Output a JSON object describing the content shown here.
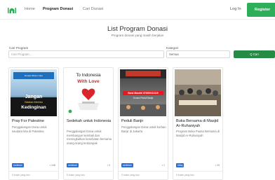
{
  "nav": {
    "links": [
      "Home",
      "Program Donasi",
      "Cari Donasi"
    ],
    "login": "Log In",
    "register": "Register"
  },
  "header": {
    "title": "List Program Donasi",
    "subtitle": "Program donasi yang masih berjalan"
  },
  "search": {
    "label": "Cari Program",
    "placeholder": "Cari Program...",
    "category_label": "Kategori",
    "category_value": "Semua",
    "button": "Q Cari"
  },
  "cards": [
    {
      "title": "Pray For Palestine",
      "desc": "Penggalangan Dana untuk saudara kita di Palestina",
      "badge": "sedekah",
      "stat": "• 148",
      "time": "5 bulan yang lalu",
      "poster": {
        "line1": "Jangan",
        "line2": "Biarkan Mereka",
        "line3": "Kedinginan",
        "line4": "Donasi Winter Care"
      }
    },
    {
      "title": "Sedekah untuk Indonesia",
      "desc": "Penggalangan Dana untuk membangun kembali dan meningkatkan kesehatan bersama orang-orang terdampak",
      "badge": "sedekah",
      "stat": "• 0",
      "time": "5 bulan yang lalu",
      "poster": {
        "line1": "To Indonesia",
        "line2": "With Love"
      }
    },
    {
      "title": "Peduli Banjir",
      "desc": "Penggalangan Dana untuk korban Banjir di Jakarta",
      "badge": "sedekah",
      "stat": "• 1",
      "time": "5 bulan yang lalu",
      "poster": {
        "line1": "Bank Mandiri 070000113119",
        "line2": "Donasi Peduli Banjir"
      }
    },
    {
      "title": "Buka Bersama di Masjid Ar-Ruhaniyah",
      "desc": "Program Buka Puasa Bersama di Masjid Ar-Ruhaniyah",
      "badge": "infaq",
      "stat": "• 15",
      "time": "5 bulan yang lalu",
      "poster": {}
    }
  ],
  "colors": {
    "brand_green": "#2daf5a",
    "button_green": "#258c46",
    "badge_blue": "#2a6fd6"
  }
}
